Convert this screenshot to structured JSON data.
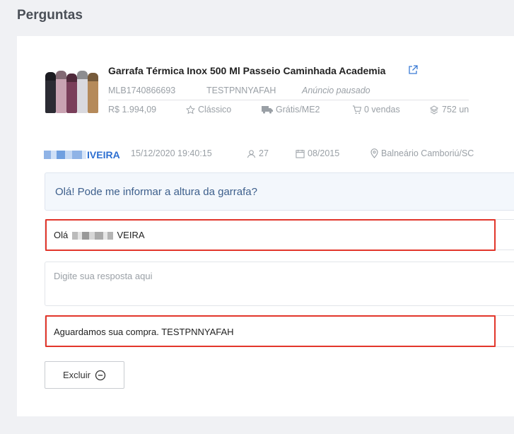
{
  "page": {
    "title": "Perguntas"
  },
  "product": {
    "title": "Garrafa Térmica Inox 500 Ml Passeio Caminhada Academia",
    "id": "MLB1740866693",
    "sku": "TESTPNNYAFAH",
    "status": "Anúncio pausado",
    "price": "R$ 1.994,09",
    "listing_type": "Clássico",
    "shipping": "Grátis/ME2",
    "sales": "0 vendas",
    "stock": "752 un",
    "thumbnail_colors": [
      "#2b2b33",
      "#c9a3b2",
      "#7a3f5a",
      "#d9d9de",
      "#b58a5a"
    ]
  },
  "question": {
    "asker_suffix": "IVEIRA",
    "datetime": "15/12/2020 19:40:15",
    "purchases": "27",
    "member_since": "08/2015",
    "location": "Balneário Camboriú/SC",
    "text": "Olá! Pode me informar a altura da garrafa?"
  },
  "answer": {
    "greeting_prefix": "Olá",
    "greeting_suffix": "VEIRA",
    "body_placeholder": "Digite sua resposta aqui",
    "closing": "Aguardamos sua compra. TESTPNNYAFAH"
  },
  "actions": {
    "delete_label": "Excluir"
  },
  "colors": {
    "highlight": "#e2362b",
    "link": "#2d6fd1",
    "question_bg": "#f3f7fc"
  }
}
